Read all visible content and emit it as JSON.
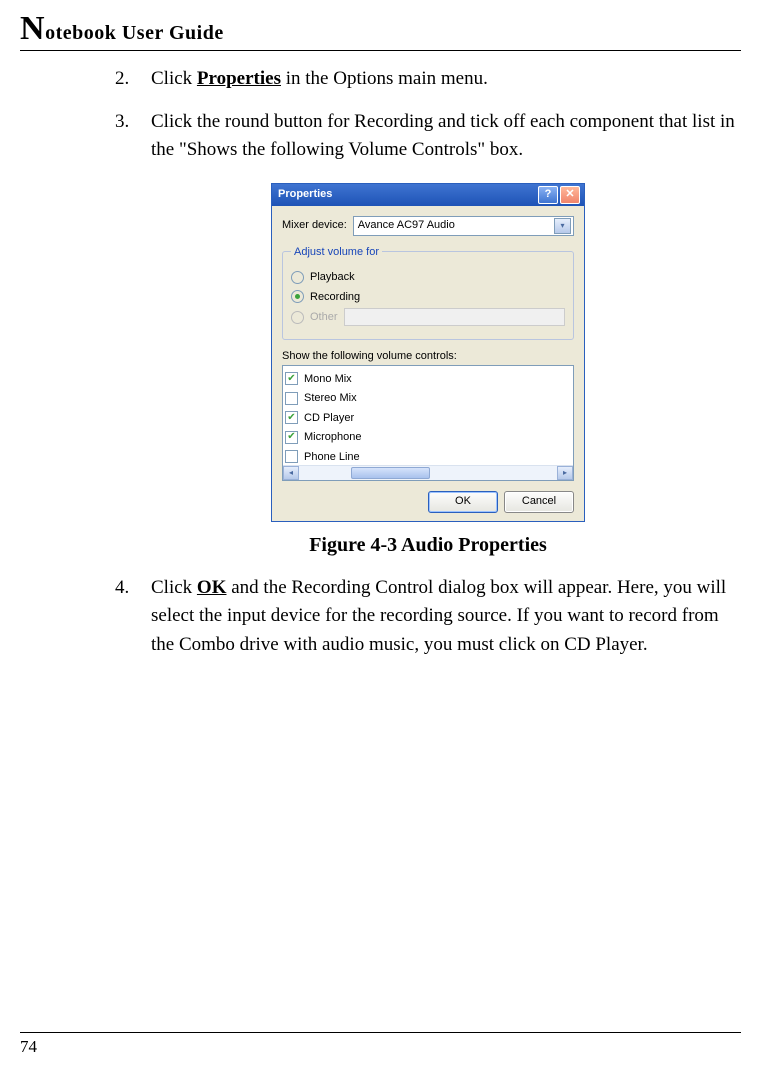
{
  "header": {
    "title_prefix": "N",
    "title_rest": "otebook User Guide"
  },
  "steps": {
    "s2": {
      "num": "2.",
      "pre": "Click ",
      "bold": "Properties",
      "post": " in the Options main menu."
    },
    "s3": {
      "num": "3.",
      "text": "Click the round button for Recording and tick off each component that list in the \"Shows the following Volume Controls\" box."
    },
    "s4": {
      "num": "4.",
      "pre": "Click ",
      "bold": "OK",
      "post": " and the Recording Control dialog box will appear. Here, you will select the input device for the recording source. If you want to record from the Combo drive with audio music, you must click on CD Player."
    }
  },
  "figure": {
    "caption": "Figure 4-3   Audio Properties"
  },
  "dialog": {
    "title": "Properties",
    "help_symbol": "?",
    "close_symbol": "✕",
    "mixer_label": "Mixer device:",
    "mixer_value": "Avance AC97 Audio",
    "group_legend": "Adjust volume for",
    "radio_playback": "Playback",
    "radio_recording": "Recording",
    "radio_other": "Other",
    "list_label": "Show the following volume controls:",
    "controls": {
      "c0": {
        "label": "Mono Mix",
        "checked": true
      },
      "c1": {
        "label": "Stereo Mix",
        "checked": false
      },
      "c2": {
        "label": "CD Player",
        "checked": true
      },
      "c3": {
        "label": "Microphone",
        "checked": true
      },
      "c4": {
        "label": "Phone Line",
        "checked": false
      }
    },
    "ok": "OK",
    "cancel": "Cancel"
  },
  "page_number": "74"
}
